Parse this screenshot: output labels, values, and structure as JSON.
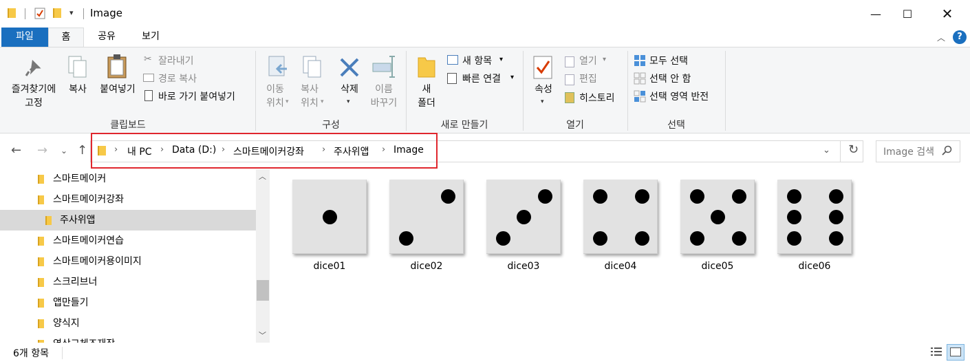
{
  "window": {
    "title": "Image"
  },
  "ribbon_tabs": [
    "파일",
    "홈",
    "공유",
    "보기"
  ],
  "clipboard": {
    "pin": "즐겨찾기에\n고정",
    "copy": "복사",
    "paste": "붙여넣기",
    "cut": "잘라내기",
    "copy_path": "경로 복사",
    "paste_shortcut": "바로 가기 붙여넣기",
    "label": "클립보드"
  },
  "organize": {
    "move_to": "이동\n위치",
    "copy_to": "복사\n위치",
    "delete": "삭제",
    "rename": "이름\n바꾸기",
    "label": "구성"
  },
  "new": {
    "new_folder": "새\n폴더",
    "new_item": "새 항목",
    "easy_access": "빠른 연결",
    "label": "새로 만들기"
  },
  "open": {
    "properties": "속성",
    "open": "열기",
    "edit": "편집",
    "history": "히스토리",
    "label": "열기"
  },
  "select": {
    "select_all": "모두 선택",
    "select_none": "선택 안 함",
    "invert": "선택 영역 반전",
    "label": "선택"
  },
  "breadcrumb": [
    "내 PC",
    "Data (D:)",
    "스마트메이커강좌",
    "주사위앱",
    "Image"
  ],
  "search": {
    "placeholder": "Image 검색"
  },
  "nav_items": [
    {
      "label": "스마트메이커",
      "selected": false
    },
    {
      "label": "스마트메이커강좌",
      "selected": false
    },
    {
      "label": "주사위앱",
      "selected": true
    },
    {
      "label": "스마트메이커연습",
      "selected": false
    },
    {
      "label": "스마트메이커용이미지",
      "selected": false
    },
    {
      "label": "스크리브너",
      "selected": false
    },
    {
      "label": "앱만들기",
      "selected": false
    },
    {
      "label": "양식지",
      "selected": false
    },
    {
      "label": "영상교체즈재작",
      "selected": false
    }
  ],
  "files": [
    {
      "name": "dice01",
      "pips": 1
    },
    {
      "name": "dice02",
      "pips": 2
    },
    {
      "name": "dice03",
      "pips": 3
    },
    {
      "name": "dice04",
      "pips": 4
    },
    {
      "name": "dice05",
      "pips": 5
    },
    {
      "name": "dice06",
      "pips": 6
    }
  ],
  "status": {
    "item_count": "6개 항목"
  },
  "colors": {
    "accent": "#1a6fbf",
    "highlight_box": "#e0262d"
  }
}
